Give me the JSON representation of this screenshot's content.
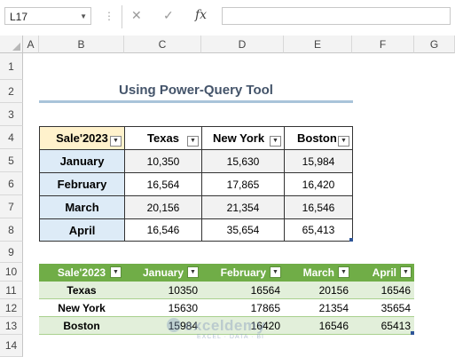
{
  "formula_bar": {
    "name_box": "L17",
    "cancel_icon": "✕",
    "enter_icon": "✓",
    "fx_label": "fx",
    "formula": ""
  },
  "columns": [
    "A",
    "B",
    "C",
    "D",
    "E",
    "F",
    "G"
  ],
  "rows": [
    "1",
    "2",
    "3",
    "4",
    "5",
    "6",
    "7",
    "8",
    "9",
    "10",
    "11",
    "12",
    "13",
    "14"
  ],
  "title": "Using Power-Query Tool",
  "table1": {
    "headers": [
      "Sale'2023",
      "Texas",
      "New York",
      "Boston"
    ],
    "rows": [
      [
        "January",
        "10,350",
        "15,630",
        "15,984"
      ],
      [
        "February",
        "16,564",
        "17,865",
        "16,420"
      ],
      [
        "March",
        "20,156",
        "21,354",
        "16,546"
      ],
      [
        "April",
        "16,546",
        "35,654",
        "65,413"
      ]
    ]
  },
  "table2": {
    "headers": [
      "Sale'2023",
      "January",
      "February",
      "March",
      "April"
    ],
    "rows": [
      [
        "Texas",
        "10350",
        "16564",
        "20156",
        "16546"
      ],
      [
        "New York",
        "15630",
        "17865",
        "21354",
        "35654"
      ],
      [
        "Boston",
        "15984",
        "16420",
        "16546",
        "65413"
      ]
    ]
  },
  "watermark": {
    "name": "exceldemy",
    "sub": "EXCEL · DATA · BI"
  },
  "colors": {
    "header_green": "#70ad47",
    "band_green": "#e2efda",
    "title_blue": "#44546a",
    "header_yellow": "#fff2cc",
    "row_blue": "#ddebf7"
  }
}
